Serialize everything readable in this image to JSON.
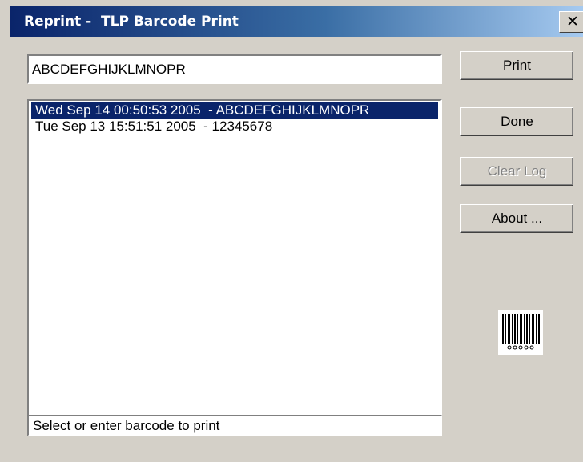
{
  "window": {
    "title": "Reprint -  TLP Barcode Print",
    "close_glyph": "✕"
  },
  "barcode_input": {
    "value": "ABCDEFGHIJKLMNOPR"
  },
  "log": {
    "items": [
      {
        "text": "Wed Sep 14 00:50:53 2005  - ABCDEFGHIJKLMNOPR",
        "selected": true
      },
      {
        "text": "Tue Sep 13 15:51:51 2005  - 12345678",
        "selected": false
      }
    ]
  },
  "buttons": {
    "print": "Print",
    "done": "Done",
    "clear_log": "Clear Log",
    "about": "About ..."
  },
  "status": {
    "text": "Select or enter barcode to print"
  },
  "icons": {
    "close": "close-icon",
    "logo": "barcode-icon"
  },
  "colors": {
    "title_start": "#0a246a",
    "title_end": "#a6caf0",
    "selection": "#0a246a",
    "face": "#d4d0c8"
  }
}
